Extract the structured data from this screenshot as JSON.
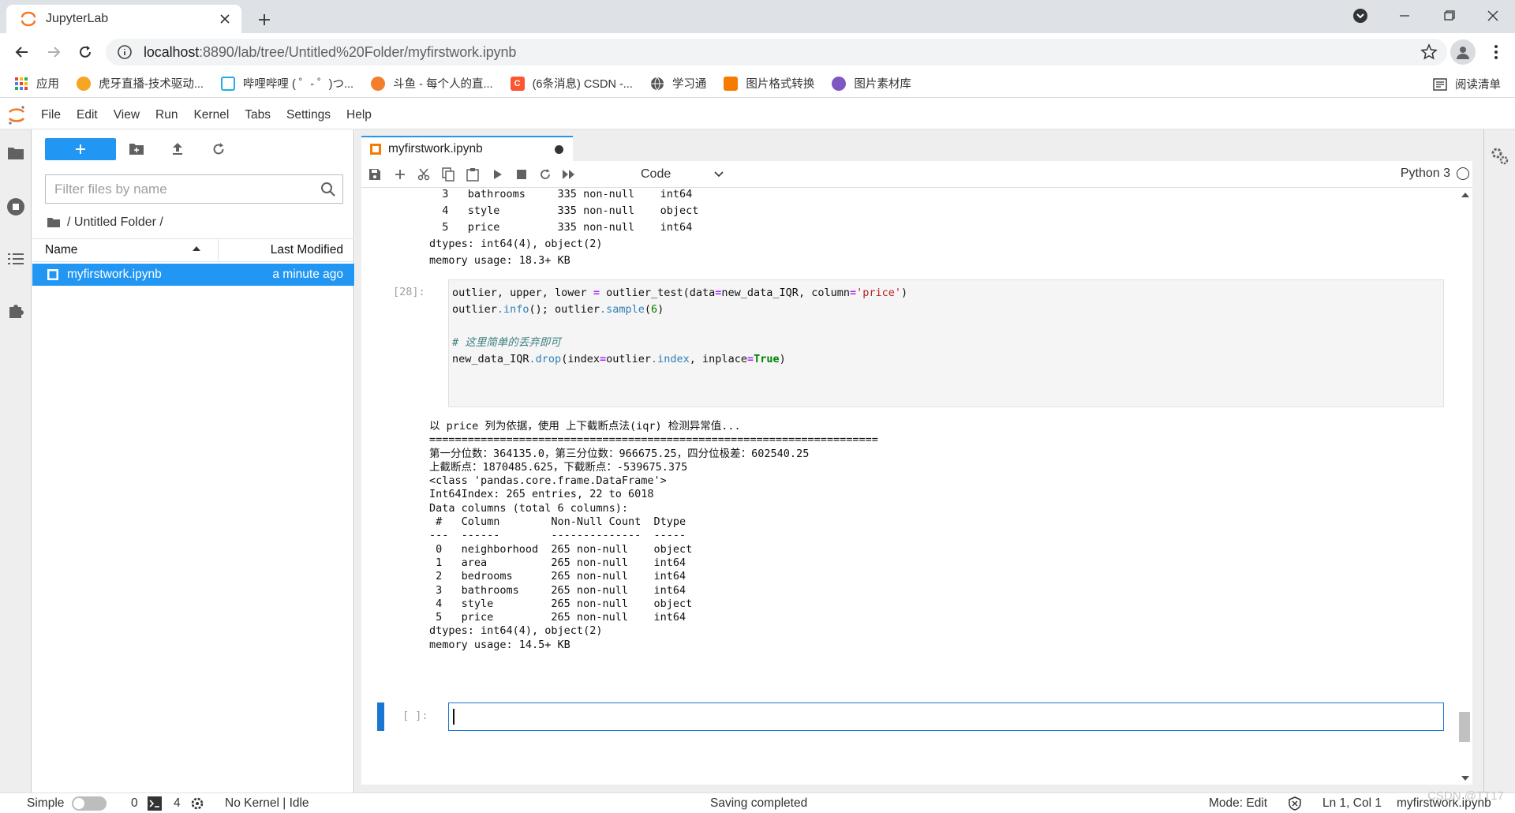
{
  "browser": {
    "tab_title": "JupyterLab",
    "url_host": "localhost",
    "url_path": ":8890/lab/tree/Untitled%20Folder/myfirstwork.ipynb",
    "bookmarks": [
      {
        "label": "应用",
        "icon": "apps-grid-icon",
        "color": "#e8453c"
      },
      {
        "label": "虎牙直播-技术驱动...",
        "icon": "huya-icon",
        "color": "#f5a623"
      },
      {
        "label": "哔哩哔哩 ( ゜- ゜)つ...",
        "icon": "bilibili-icon",
        "color": "#23ade5"
      },
      {
        "label": "斗鱼 - 每个人的直...",
        "icon": "douyu-icon",
        "color": "#f37d2c"
      },
      {
        "label": "(6条消息) CSDN -...",
        "icon": "csdn-icon",
        "color": "#fc5531"
      },
      {
        "label": "学习通",
        "icon": "globe-icon",
        "color": "#555555"
      },
      {
        "label": "图片格式转换",
        "icon": "image-convert-icon",
        "color": "#f57c00"
      },
      {
        "label": "图片素材库",
        "icon": "image-library-icon",
        "color": "#7e57c2"
      }
    ],
    "reading_list": "阅读清单"
  },
  "menubar": [
    "File",
    "Edit",
    "View",
    "Run",
    "Kernel",
    "Tabs",
    "Settings",
    "Help"
  ],
  "filebrowser": {
    "filter_placeholder": "Filter files by name",
    "breadcrumb": "/ Untitled Folder /",
    "col_name": "Name",
    "col_modified": "Last Modified",
    "files": [
      {
        "name": "myfirstwork.ipynb",
        "modified": "a minute ago"
      }
    ]
  },
  "notebook": {
    "tab_title": "myfirstwork.ipynb",
    "cell_type": "Code",
    "kernel": "Python 3",
    "output_top": "  3   bathrooms     335 non-null    int64 \n  4   style         335 non-null    object\n  5   price         335 non-null    int64 \ndtypes: int64(4), object(2)\nmemory usage: 18.3+ KB",
    "cell_prompt": "[28]:",
    "code_lines": {
      "l1_a": "outlier, upper, lower ",
      "l1_op": "=",
      "l1_b": " outlier_test(data",
      "l1_op2": "=",
      "l1_c": "new_data_IQR, column",
      "l1_op3": "=",
      "l1_str": "'price'",
      "l1_d": ")",
      "l2_a": "outlier",
      "l2_attr": ".info",
      "l2_b": "(); outlier",
      "l2_attr2": ".sample",
      "l2_c": "(",
      "l2_num": "6",
      "l2_d": ")",
      "comment": "# 这里简单的丢弃即可",
      "l4_a": "new_data_IQR",
      "l4_attr": ".drop",
      "l4_b": "(index",
      "l4_op": "=",
      "l4_c": "outlier",
      "l4_attr2": ".index",
      "l4_d": ", inplace",
      "l4_op2": "=",
      "l4_kw": "True",
      "l4_e": ")"
    },
    "output_main": "以 price 列为依据，使用 上下截断点法(iqr) 检测异常值...\n======================================================================\n第一分位数：364135.0，第三分位数：966675.25，四分位极差：602540.25\n上截断点：1870485.625，下截断点：-539675.375\n<class 'pandas.core.frame.DataFrame'>\nInt64Index: 265 entries, 22 to 6018\nData columns (total 6 columns):\n #   Column        Non-Null Count  Dtype \n---  ------        --------------  ----- \n 0   neighborhood  265 non-null    object\n 1   area          265 non-null    int64 \n 2   bedrooms      265 non-null    int64 \n 3   bathrooms     265 non-null    int64 \n 4   style         265 non-null    object\n 5   price         265 non-null    int64 \ndtypes: int64(4), object(2)\nmemory usage: 14.5+ KB",
    "empty_prompt": "[ ]:"
  },
  "statusbar": {
    "mode_simple": "Simple",
    "terminals": "0",
    "kernels": "4",
    "kernel_state": "No Kernel | Idle",
    "saving": "Saving completed",
    "mode": "Mode: Edit",
    "cursor": "Ln 1, Col 1",
    "file": "myfirstwork.ipynb"
  },
  "watermark": "CSDN @TT17"
}
